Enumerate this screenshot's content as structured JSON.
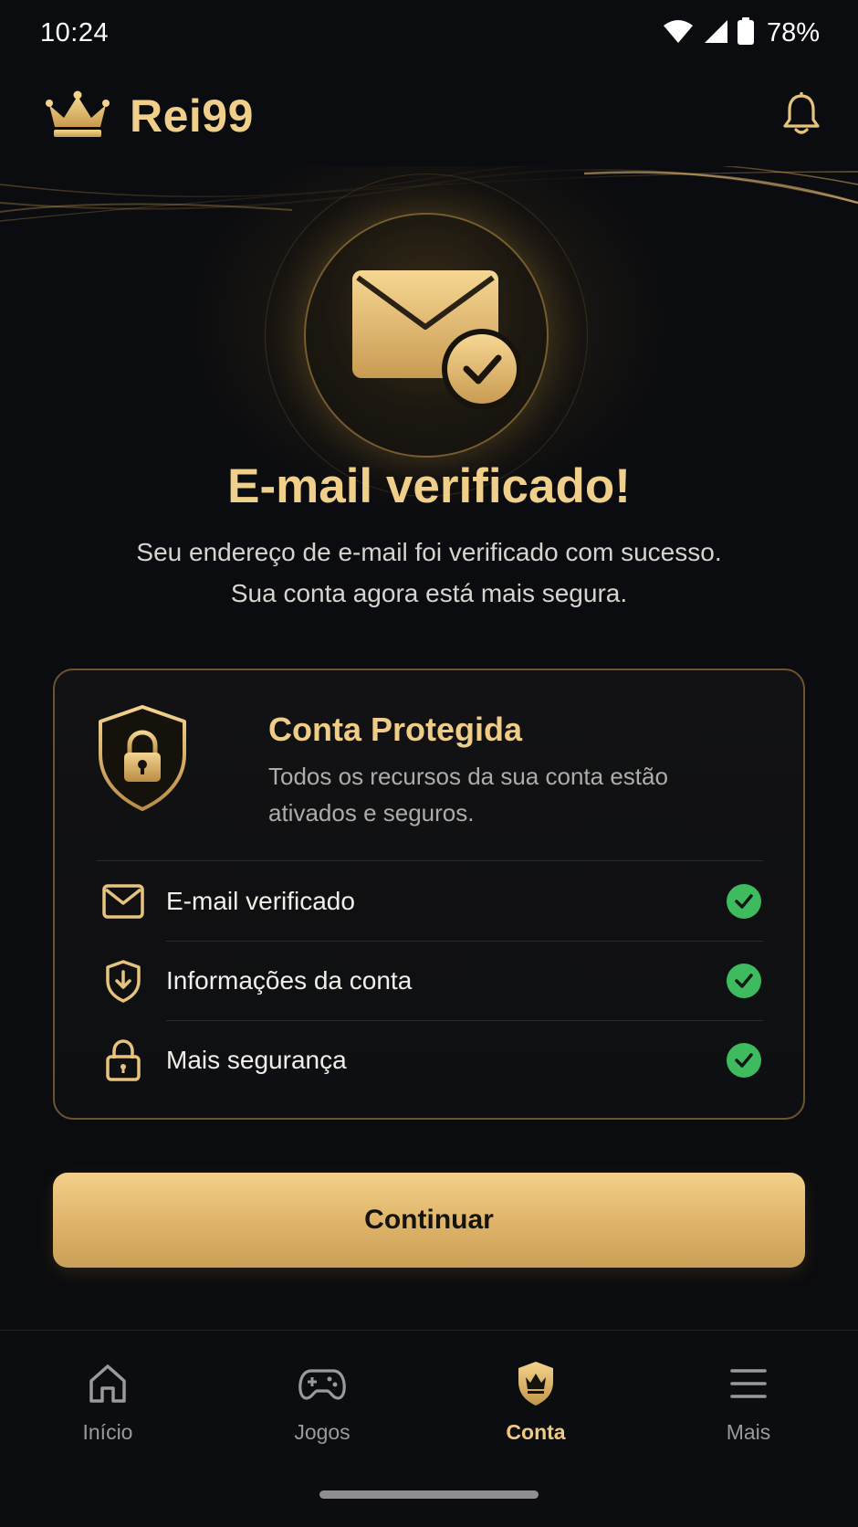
{
  "status_bar": {
    "time": "10:24",
    "battery": "78%",
    "icons": [
      "wifi-icon",
      "signal-icon",
      "battery-icon"
    ]
  },
  "header": {
    "brand": "Rei99",
    "logo_icon": "crown-icon",
    "notification_icon": "bell-icon"
  },
  "hero": {
    "icon": "mail-check-icon",
    "title": "E-mail verificado!",
    "subtitle_line1": "Seu endereço de e-mail foi verificado com sucesso.",
    "subtitle_line2": "Sua conta agora está mais segura."
  },
  "card": {
    "icon": "shield-lock-icon",
    "title": "Conta Protegida",
    "description": "Todos os recursos da sua conta estão ativados e seguros.",
    "items": [
      {
        "label": "E-mail verificado",
        "icon": "mail-icon",
        "status": "check-icon"
      },
      {
        "label": "Informações da conta",
        "icon": "shield-download-icon",
        "status": "check-icon"
      },
      {
        "label": "Mais segurança",
        "icon": "lock-icon",
        "status": "check-icon"
      }
    ]
  },
  "continue_label": "Continuar",
  "nav": {
    "items": [
      {
        "label": "Início",
        "icon": "home-icon"
      },
      {
        "label": "Jogos",
        "icon": "gamepad-icon"
      },
      {
        "label": "Conta",
        "icon": "crown-shield-icon",
        "active": true
      },
      {
        "label": "Mais",
        "icon": "menu-icon"
      }
    ]
  },
  "colors": {
    "background": "#0b0c0f",
    "gold": "#efcf8a",
    "success": "#3dbb5e",
    "muted": "#9a9a9e"
  }
}
